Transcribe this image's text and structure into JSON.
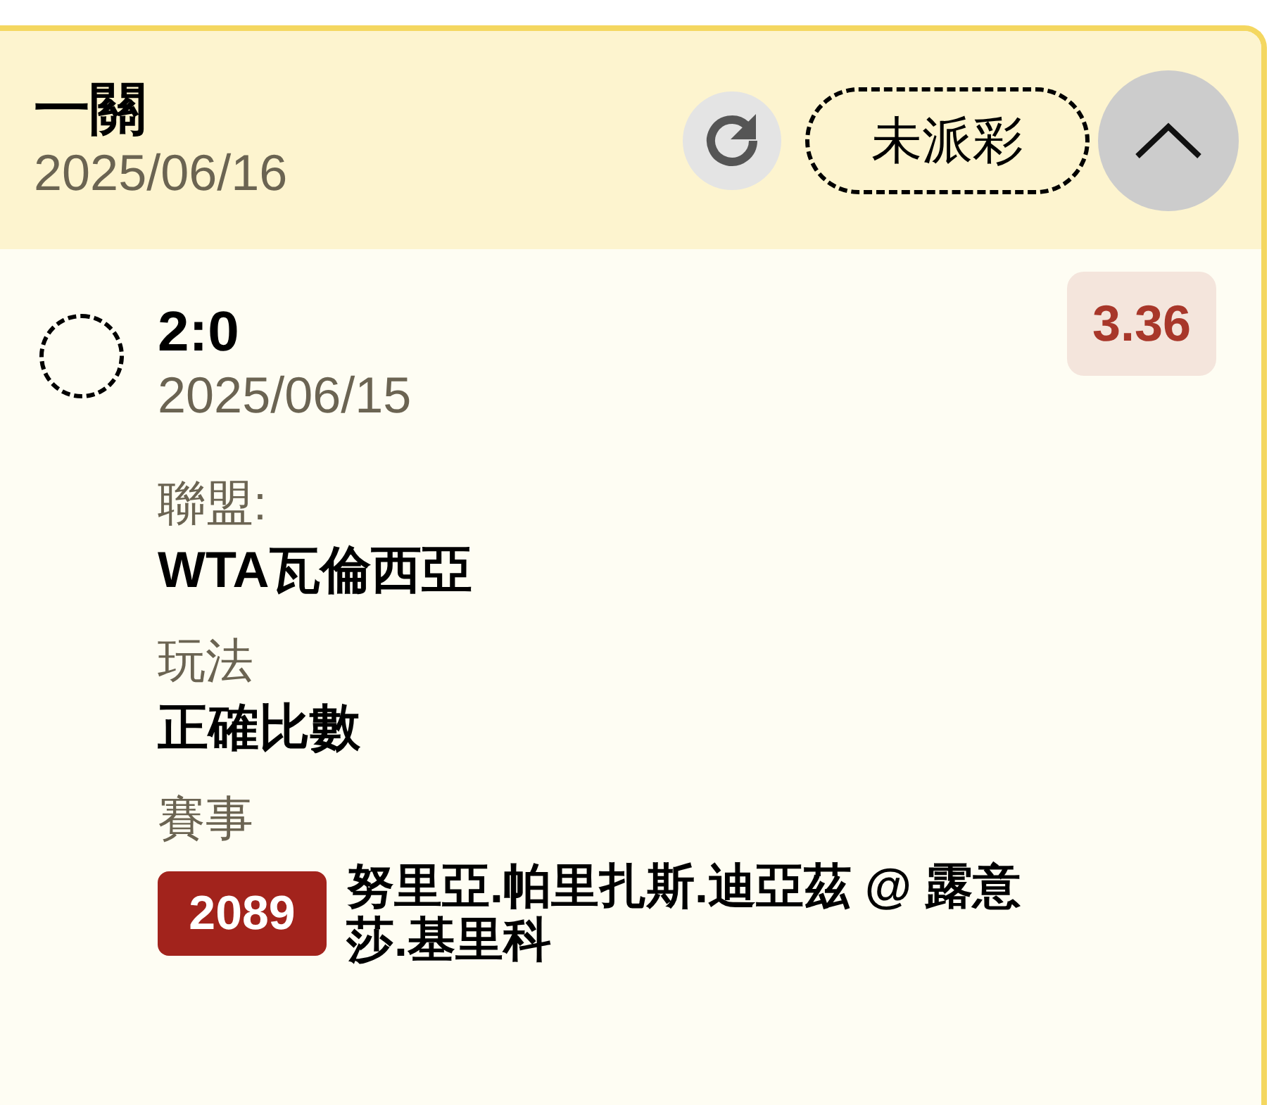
{
  "ticket": {
    "title": "一關",
    "date": "2025/06/16",
    "status": "未派彩",
    "expanded": true
  },
  "selections": [
    {
      "settled": false,
      "score": "2:0",
      "date": "2025/06/15",
      "odds": "3.36",
      "fields": [
        {
          "kind": "text",
          "label": "聯盟:",
          "value": "WTA瓦倫西亞"
        },
        {
          "kind": "text",
          "label": "玩法",
          "value": "正確比數"
        },
        {
          "kind": "event",
          "label": "賽事",
          "match_number": "2089",
          "value": "努里亞.帕里扎斯.迪亞茲 @ 露意莎.基里科"
        }
      ]
    }
  ]
}
